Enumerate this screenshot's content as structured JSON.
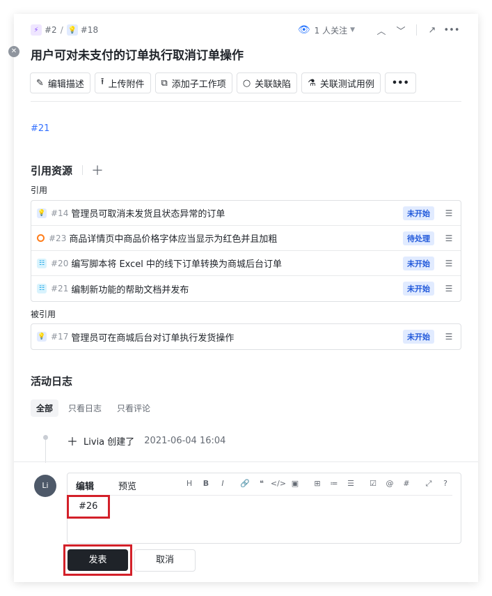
{
  "breadcrumb": {
    "parent_id": "#2",
    "current_id": "#18",
    "separator": "/"
  },
  "header": {
    "followers_label": "1 人关注",
    "title": "用户可对未支付的订单执行取消订单操作"
  },
  "actions": [
    {
      "label": "编辑描述",
      "icon": "pencil-icon"
    },
    {
      "label": "上传附件",
      "icon": "upload-icon"
    },
    {
      "label": "添加子工作项",
      "icon": "subitem-icon"
    },
    {
      "label": "关联缺陷",
      "icon": "bug-icon"
    },
    {
      "label": "关联测试用例",
      "icon": "flask-icon"
    }
  ],
  "more_label": "•••",
  "description": {
    "link": "#21"
  },
  "references": {
    "title": "引用资源",
    "refs_label": "引用",
    "refs": [
      {
        "id": "#14",
        "title": "管理员可取消未发货且状态异常的订单",
        "status": "未开始",
        "type": "requirement"
      },
      {
        "id": "#23",
        "title": "商品详情页中商品价格字体应当显示为红色并且加粗",
        "status": "待处理",
        "type": "bug"
      },
      {
        "id": "#20",
        "title": "编写脚本将 Excel 中的线下订单转换为商城后台订单",
        "status": "未开始",
        "type": "task"
      },
      {
        "id": "#21",
        "title": "编制新功能的帮助文档并发布",
        "status": "未开始",
        "type": "task"
      }
    ],
    "cited_label": "被引用",
    "cited": [
      {
        "id": "#17",
        "title": "管理员可在商城后台对订单执行发货操作",
        "status": "未开始",
        "type": "requirement"
      }
    ]
  },
  "activity": {
    "title": "活动日志",
    "filters": [
      "全部",
      "只看日志",
      "只看评论"
    ],
    "entry": {
      "text": "Livia 创建了",
      "time": "2021-06-04 16:04"
    }
  },
  "comment": {
    "avatar": "Li",
    "tabs": [
      "编辑",
      "预览"
    ],
    "tools": [
      "H",
      "B",
      "I",
      "🔗",
      "❝",
      "</>",
      "▣",
      "⊞",
      "≔",
      "☰",
      "☑",
      "@",
      "#",
      "⤢",
      "?"
    ],
    "content": "#26",
    "submit_label": "发表",
    "cancel_label": "取消"
  },
  "colors": {
    "accent": "#3370ff",
    "highlight": "#d32029",
    "primary_button": "#1f2329"
  }
}
